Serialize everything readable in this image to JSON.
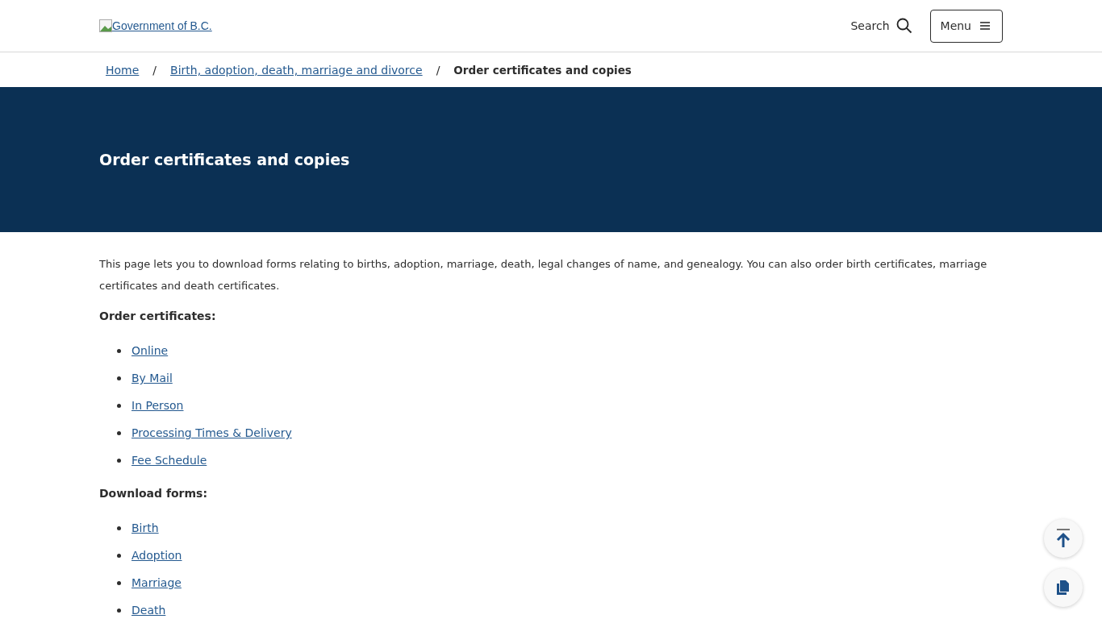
{
  "header": {
    "logo_alt": "Government of B.C.",
    "search_label": "Search",
    "menu_label": "Menu"
  },
  "breadcrumb": [
    {
      "label": "Home",
      "kind": "link"
    },
    {
      "label": "Birth, adoption, death, marriage and divorce",
      "kind": "link"
    },
    {
      "label": "Order certificates and copies",
      "kind": "current"
    }
  ],
  "breadcrumb_separator": "/",
  "banner": {
    "title": "Order certificates and copies"
  },
  "intro": "This page lets you to download forms relating to births, adoption, marriage, death, legal changes of name, and genealogy. You can also order birth certificates, marriage certificates and death certificates.",
  "sections": [
    {
      "heading": "Order certificates:",
      "links": [
        "Online",
        "By Mail",
        "In Person",
        "Processing Times & Delivery",
        "Fee Schedule"
      ]
    },
    {
      "heading": "Download forms:",
      "links": [
        "Birth",
        "Adoption",
        "Marriage",
        "Death"
      ]
    }
  ]
}
